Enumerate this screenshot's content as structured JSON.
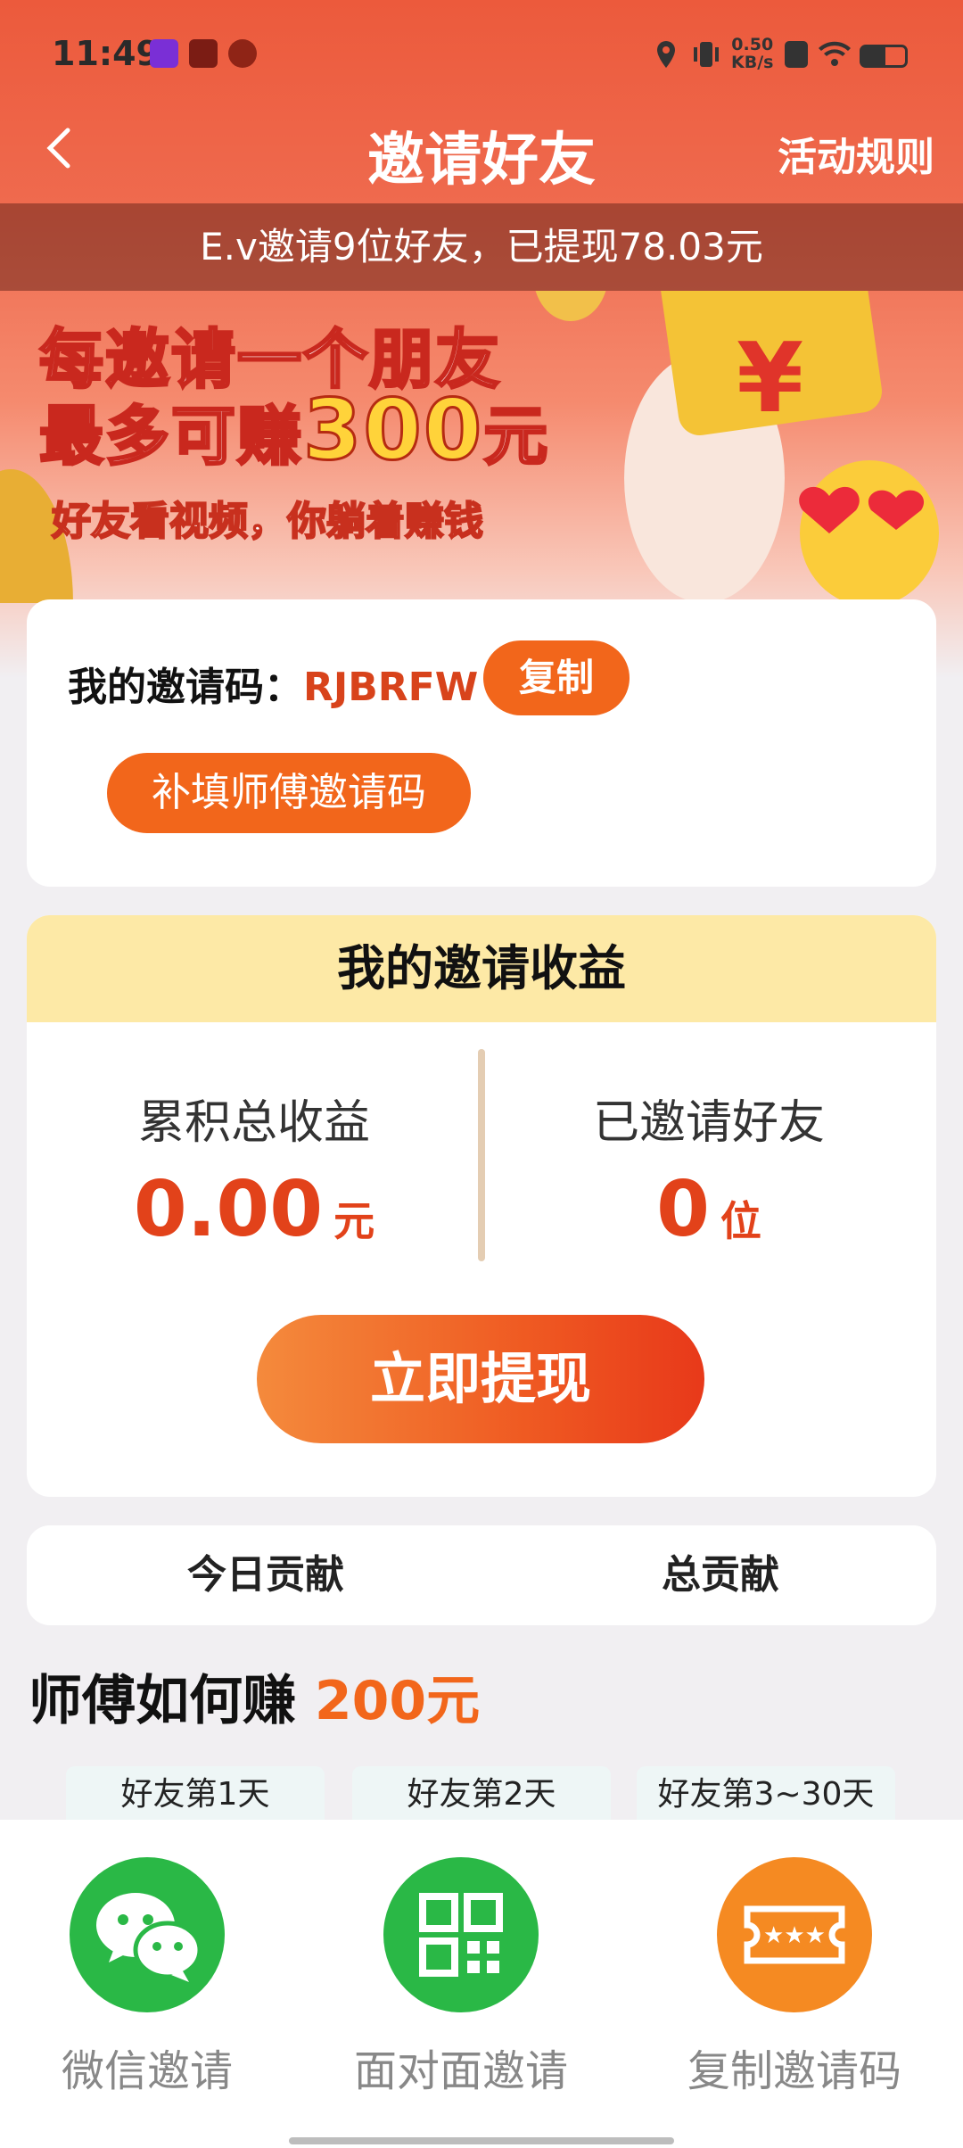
{
  "status_bar": {
    "time": "11:49",
    "net_speed": "0.50",
    "net_unit": "KB/s"
  },
  "header": {
    "title": "邀请好友",
    "rules_label": "活动规则"
  },
  "notice": "E.v邀请9位好友，已提现78.03元",
  "banner": {
    "line1": "每邀请一个朋友",
    "line2_pre": "最多可赚",
    "line2_amount": "300",
    "line2_post": "元",
    "subtitle": "好友看视频，你躺着赚钱",
    "coupon_symbol": "¥"
  },
  "invite_code": {
    "label": "我的邀请码：",
    "value": "RJBRFW",
    "copy_label": "复制",
    "fill_label": "补填师傅邀请码"
  },
  "earnings": {
    "title": "我的邀请收益",
    "total_label": "累积总收益",
    "total_value": "0.00",
    "total_unit": "元",
    "friends_label": "已邀请好友",
    "friends_value": "0",
    "friends_unit": "位",
    "withdraw_label": "立即提现"
  },
  "contribution": {
    "today_label": "今日贡献",
    "total_label": "总贡献"
  },
  "how_to_earn": {
    "prefix": "师傅如何赚",
    "amount": "200元"
  },
  "days": [
    "好友第1天",
    "好友第2天",
    "好友第3~30天"
  ],
  "share": [
    {
      "label": "微信邀请",
      "icon": "wechat-icon",
      "color": "#2ab846"
    },
    {
      "label": "面对面邀请",
      "icon": "qr-code-icon",
      "color": "#2ab846"
    },
    {
      "label": "复制邀请码",
      "icon": "ticket-icon",
      "color": "#f58a22"
    }
  ],
  "colors": {
    "primary": "#ec5a3c",
    "accent": "#f2661b",
    "number": "#e2421a"
  }
}
